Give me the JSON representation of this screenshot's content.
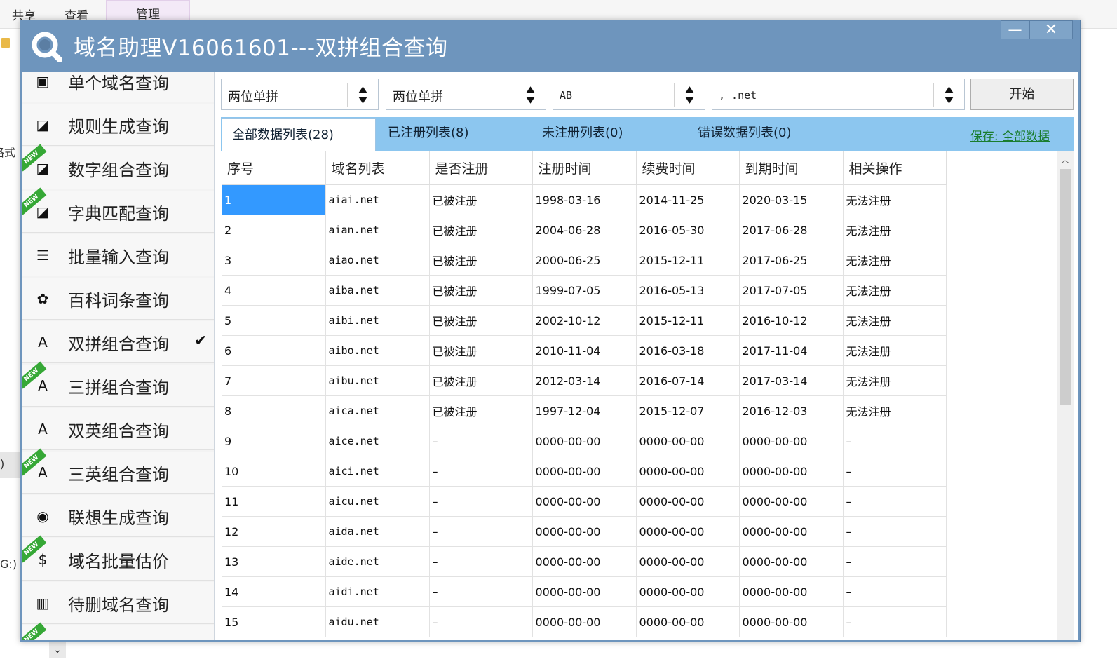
{
  "background": {
    "ribbon_tabs": [
      "共享",
      "查看",
      "管理"
    ],
    "left_fragments": [
      "格式",
      ")",
      "G:)"
    ]
  },
  "window": {
    "title": "域名助理V16061601---双拼组合查询",
    "minimize_glyph": "—",
    "close_glyph": "✕"
  },
  "sidebar": {
    "items": [
      {
        "label": "单个域名查询",
        "icon": "terminal-icon",
        "glyph": "▣",
        "new": false,
        "checked": false
      },
      {
        "label": "规则生成查询",
        "icon": "grid-icon",
        "glyph": "◪",
        "new": false,
        "checked": false
      },
      {
        "label": "数字组合查询",
        "icon": "grid-icon",
        "glyph": "◪",
        "new": true,
        "checked": false
      },
      {
        "label": "字典匹配查询",
        "icon": "grid-icon",
        "glyph": "◪",
        "new": true,
        "checked": false
      },
      {
        "label": "批量输入查询",
        "icon": "indent-list-icon",
        "glyph": "☰",
        "new": false,
        "checked": false
      },
      {
        "label": "百科词条查询",
        "icon": "paw-icon",
        "glyph": "✿",
        "new": false,
        "checked": false
      },
      {
        "label": "双拼组合查询",
        "icon": "font-icon",
        "glyph": "A",
        "new": false,
        "checked": true
      },
      {
        "label": "三拼组合查询",
        "icon": "font-icon",
        "glyph": "A",
        "new": true,
        "checked": false
      },
      {
        "label": "双英组合查询",
        "icon": "letter-box-icon",
        "glyph": "A",
        "new": false,
        "checked": false
      },
      {
        "label": "三英组合查询",
        "icon": "letter-box-icon",
        "glyph": "A",
        "new": true,
        "checked": false
      },
      {
        "label": "联想生成查询",
        "icon": "broadcast-icon",
        "glyph": "◉",
        "new": false,
        "checked": false
      },
      {
        "label": "域名批量估价",
        "icon": "price-tag-icon",
        "glyph": "$",
        "new": true,
        "checked": false
      },
      {
        "label": "待删域名查询",
        "icon": "trash-icon",
        "glyph": "▥",
        "new": false,
        "checked": false
      },
      {
        "label": "",
        "icon": "partial-item-icon",
        "glyph": "",
        "new": true,
        "checked": false
      }
    ],
    "new_badge": "NEW",
    "check_glyph": "✔"
  },
  "toolbar": {
    "combo1": "两位单拼",
    "combo2": "两位单拼",
    "combo3": "AB",
    "combo4": ", .net",
    "start_label": "开始"
  },
  "tabs": {
    "all": "全部数据列表(28)",
    "registered": "已注册列表(8)",
    "unregistered": "未注册列表(0)",
    "error": "错误数据列表(0)",
    "save_link": "保存: 全部数据"
  },
  "table": {
    "columns": [
      "序号",
      "域名列表",
      "是否注册",
      "注册时间",
      "续费时间",
      "到期时间",
      "相关操作"
    ],
    "rows": [
      [
        "1",
        "aiai.net",
        "已被注册",
        "1998-03-16",
        "2014-11-25",
        "2020-03-15",
        "无法注册"
      ],
      [
        "2",
        "aian.net",
        "已被注册",
        "2004-06-28",
        "2016-05-30",
        "2017-06-28",
        "无法注册"
      ],
      [
        "3",
        "aiao.net",
        "已被注册",
        "2000-06-25",
        "2015-12-11",
        "2017-06-25",
        "无法注册"
      ],
      [
        "4",
        "aiba.net",
        "已被注册",
        "1999-07-05",
        "2016-05-13",
        "2017-07-05",
        "无法注册"
      ],
      [
        "5",
        "aibi.net",
        "已被注册",
        "2002-10-12",
        "2015-12-11",
        "2016-10-12",
        "无法注册"
      ],
      [
        "6",
        "aibo.net",
        "已被注册",
        "2010-11-04",
        "2016-03-18",
        "2017-11-04",
        "无法注册"
      ],
      [
        "7",
        "aibu.net",
        "已被注册",
        "2012-03-14",
        "2016-07-14",
        "2017-03-14",
        "无法注册"
      ],
      [
        "8",
        "aica.net",
        "已被注册",
        "1997-12-04",
        "2015-12-07",
        "2016-12-03",
        "无法注册"
      ],
      [
        "9",
        "aice.net",
        "–",
        "0000-00-00",
        "0000-00-00",
        "0000-00-00",
        "–"
      ],
      [
        "10",
        "aici.net",
        "–",
        "0000-00-00",
        "0000-00-00",
        "0000-00-00",
        "–"
      ],
      [
        "11",
        "aicu.net",
        "–",
        "0000-00-00",
        "0000-00-00",
        "0000-00-00",
        "–"
      ],
      [
        "12",
        "aida.net",
        "–",
        "0000-00-00",
        "0000-00-00",
        "0000-00-00",
        "–"
      ],
      [
        "13",
        "aide.net",
        "–",
        "0000-00-00",
        "0000-00-00",
        "0000-00-00",
        "–"
      ],
      [
        "14",
        "aidi.net",
        "–",
        "0000-00-00",
        "0000-00-00",
        "0000-00-00",
        "–"
      ],
      [
        "15",
        "aidu.net",
        "–",
        "0000-00-00",
        "0000-00-00",
        "0000-00-00",
        "–"
      ]
    ]
  },
  "colors": {
    "title_bar": "#6e95bd",
    "tab_strip": "#8cc6ef",
    "selection": "#3399ff",
    "new_badge": "#36a836",
    "save_link": "#1a7d2e"
  }
}
